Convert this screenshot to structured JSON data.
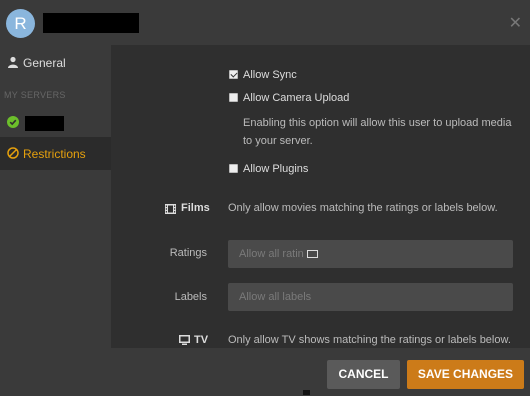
{
  "header": {
    "avatar_letter": "R",
    "close_glyph": "✕"
  },
  "sidebar": {
    "general_label": "General",
    "group_label": "MY SERVERS",
    "restrictions_label": "Restrictions"
  },
  "options": {
    "allow_sync": "Allow Sync",
    "allow_sync_checked": true,
    "allow_camera_upload": "Allow Camera Upload",
    "allow_camera_upload_checked": false,
    "camera_help": "Enabling this option will allow this user to upload media to your server.",
    "allow_plugins": "Allow Plugins",
    "allow_plugins_checked": false
  },
  "films": {
    "heading": "Films",
    "description": "Only allow movies matching the ratings or labels below.",
    "ratings_label": "Ratings",
    "ratings_placeholder": "Allow all ratin",
    "labels_label": "Labels",
    "labels_placeholder": "Allow all labels"
  },
  "tv": {
    "heading": "TV",
    "description": "Only allow TV shows matching the ratings or labels below."
  },
  "footer": {
    "cancel_label": "CANCEL",
    "save_label": "SAVE CHANGES"
  },
  "colors": {
    "accent": "#e5a00d",
    "save_button": "#cc7b19",
    "check_green": "#6cbf2b"
  }
}
